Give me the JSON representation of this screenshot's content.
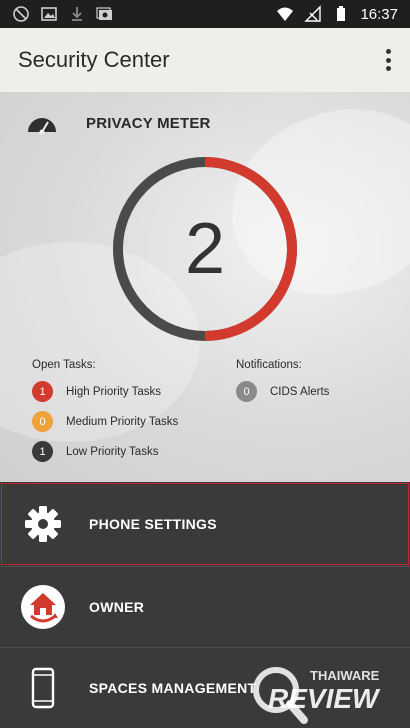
{
  "status_bar": {
    "time": "16:37"
  },
  "app_bar": {
    "title": "Security Center"
  },
  "privacy_meter": {
    "title": "PRIVACY METER",
    "value": "2",
    "progress_fraction": 0.5,
    "colors": {
      "progress": "#d23a2e",
      "track": "#4a4a4a"
    }
  },
  "open_tasks": {
    "label": "Open Tasks:",
    "items": [
      {
        "count": "1",
        "label": "High Priority Tasks",
        "color": "#d23a2e"
      },
      {
        "count": "0",
        "label": "Medium Priority Tasks",
        "color": "#efa13a"
      },
      {
        "count": "1",
        "label": "Low Priority Tasks",
        "color": "#3a3a3a"
      }
    ]
  },
  "notifications": {
    "label": "Notifications:",
    "items": [
      {
        "count": "0",
        "label": "CIDS Alerts",
        "color": "#8a8a8a"
      }
    ]
  },
  "menu": {
    "items": [
      {
        "label": "PHONE SETTINGS",
        "icon": "gear-icon"
      },
      {
        "label": "OWNER",
        "icon": "home-icon"
      },
      {
        "label": "SPACES MANAGEMENT",
        "icon": "phone-icon"
      }
    ]
  },
  "watermark": {
    "brand_top": "THAIWARE",
    "brand_bottom": "REVIEW"
  }
}
